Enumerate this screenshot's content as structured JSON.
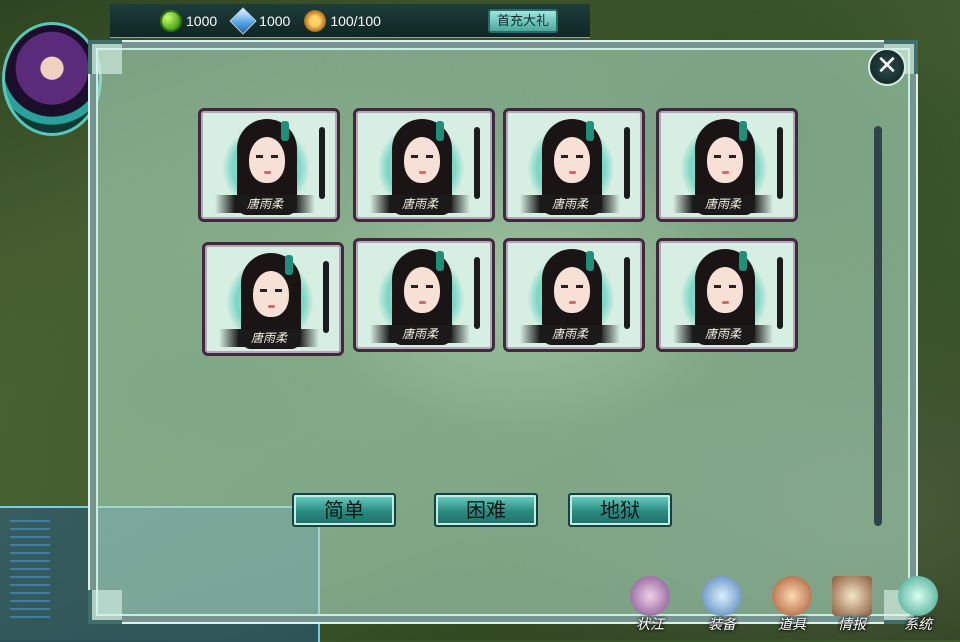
{
  "resources": {
    "jade": "1000",
    "gem": "1000",
    "stamina": "100/100"
  },
  "recharge_label": "首充大礼",
  "cards": [
    {
      "name": "唐雨柔"
    },
    {
      "name": "唐雨柔"
    },
    {
      "name": "唐雨柔"
    },
    {
      "name": "唐雨柔"
    },
    {
      "name": "唐雨柔"
    },
    {
      "name": "唐雨柔"
    },
    {
      "name": "唐雨柔"
    },
    {
      "name": "唐雨柔"
    }
  ],
  "difficulty": {
    "easy": "简单",
    "hard": "困难",
    "hell": "地狱"
  },
  "menu": {
    "martial": "状江",
    "equip": "装备",
    "items": "道具",
    "intel": "情报",
    "system": "系统"
  },
  "close_symbol": "✕",
  "colors": {
    "panel": "#b0e0c8",
    "button": "#2a8a80",
    "card_border": "#3d2a3c"
  }
}
